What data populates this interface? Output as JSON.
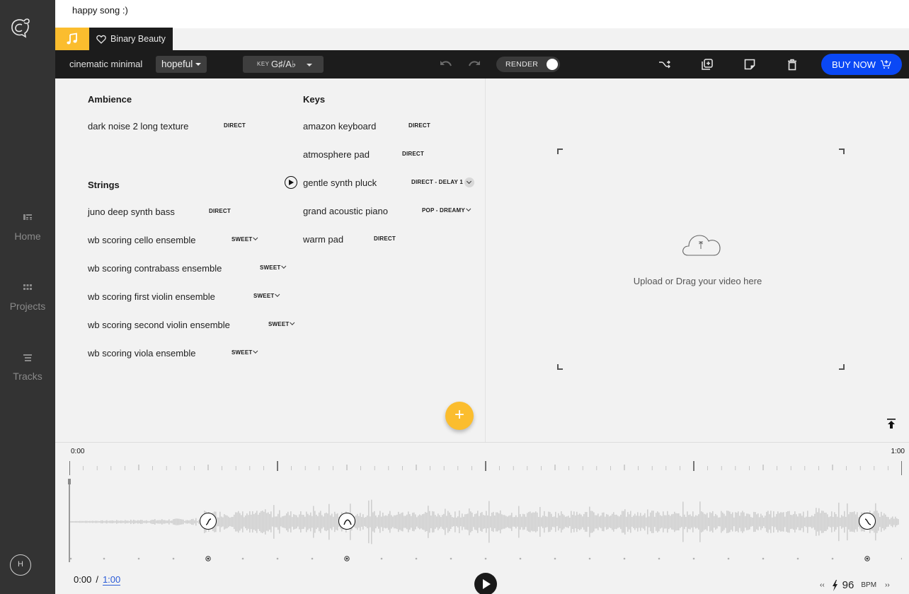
{
  "window": {
    "title": "happy song :)"
  },
  "tabs": [
    {
      "icon": "music-note-icon"
    },
    {
      "icon": "heart-icon",
      "label": "Binary Beauty"
    }
  ],
  "sidebar": {
    "items": [
      {
        "label": "Home",
        "icon": "home-icon"
      },
      {
        "label": "Projects",
        "icon": "grid-icon"
      },
      {
        "label": "Tracks",
        "icon": "list-icon"
      }
    ],
    "avatar_initial": "H"
  },
  "toolbar": {
    "style": "cinematic minimal",
    "mood": "hopeful",
    "key_label": "KEY",
    "key_value": "G♯/A♭",
    "render_label": "RENDER",
    "render_on": true,
    "buy_label": "BUY NOW",
    "icons": [
      "undo-icon",
      "redo-icon",
      "shuffle-icon",
      "duplicate-icon",
      "note-icon",
      "trash-icon",
      "cart-icon"
    ]
  },
  "instruments": {
    "groups": [
      {
        "name": "Ambience",
        "items": [
          {
            "name": "dark noise 2 long texture",
            "preset": "DIRECT",
            "dropdown": false
          }
        ]
      },
      {
        "name": "Strings",
        "items": [
          {
            "name": "juno deep synth bass",
            "preset": "DIRECT",
            "dropdown": false
          },
          {
            "name": "wb scoring cello ensemble",
            "preset": "SWEET",
            "dropdown": true
          },
          {
            "name": "wb scoring contrabass ensemble",
            "preset": "SWEET",
            "dropdown": true
          },
          {
            "name": "wb scoring first violin ensemble",
            "preset": "SWEET",
            "dropdown": true
          },
          {
            "name": "wb scoring second violin ensemble",
            "preset": "SWEET",
            "dropdown": true
          },
          {
            "name": "wb scoring viola ensemble",
            "preset": "SWEET",
            "dropdown": true
          }
        ]
      },
      {
        "name": "Keys",
        "items": [
          {
            "name": "amazon keyboard",
            "preset": "DIRECT",
            "dropdown": false
          },
          {
            "name": "atmosphere pad",
            "preset": "DIRECT",
            "dropdown": false
          },
          {
            "name": "gentle synth pluck",
            "preset": "DIRECT - DELAY 1",
            "dropdown": true,
            "hovered": true
          },
          {
            "name": "grand acoustic piano",
            "preset": "POP - DREAMY",
            "dropdown": true
          },
          {
            "name": "warm pad",
            "preset": "DIRECT",
            "dropdown": false
          }
        ]
      }
    ]
  },
  "video": {
    "upload_text": "Upload or Drag your video here"
  },
  "timeline": {
    "start_label": "0:00",
    "end_label": "1:00",
    "current_time": "0:00",
    "separator": "/",
    "total_time": "1:00",
    "duration_seconds": 60,
    "section_markers": [
      {
        "time_fraction": 0.167,
        "type": "rise"
      },
      {
        "time_fraction": 0.333,
        "type": "peak"
      },
      {
        "time_fraction": 0.958,
        "type": "fall"
      }
    ],
    "bpm": "96",
    "bpm_unit": "BPM",
    "bpm_prev": "‹‹",
    "bpm_next": "››"
  }
}
